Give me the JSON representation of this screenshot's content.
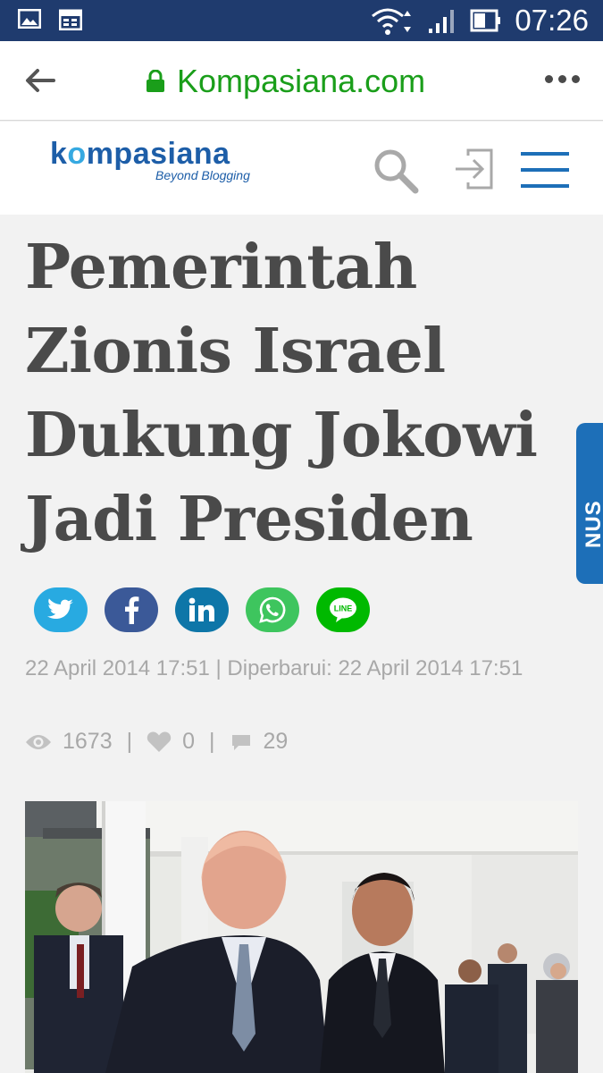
{
  "status_bar": {
    "time": "07:26",
    "icons": [
      "image-icon",
      "calendar-icon",
      "wifi-icon",
      "signal-icon",
      "battery-icon"
    ]
  },
  "browser": {
    "url": "Kompasiana.com",
    "url_color": "#1a9e1a"
  },
  "site": {
    "logo_text_a": "k",
    "logo_text_o": "o",
    "logo_text_b": "mpasiana",
    "tagline": "Beyond Blogging",
    "brand_color": "#1d5ea8"
  },
  "article": {
    "title": "Pemerintah Zionis Israel Dukung Jokowi Jadi Presiden",
    "share_buttons": [
      "twitter",
      "facebook",
      "linkedin",
      "whatsapp",
      "line"
    ],
    "line_label": "LINE",
    "meta": "22 April 2014   17:51  |  Diperbarui: 22 April 2014 17:51",
    "views": "1673",
    "likes": "0",
    "comments": "29"
  },
  "side_tab": {
    "label": "NUS"
  }
}
